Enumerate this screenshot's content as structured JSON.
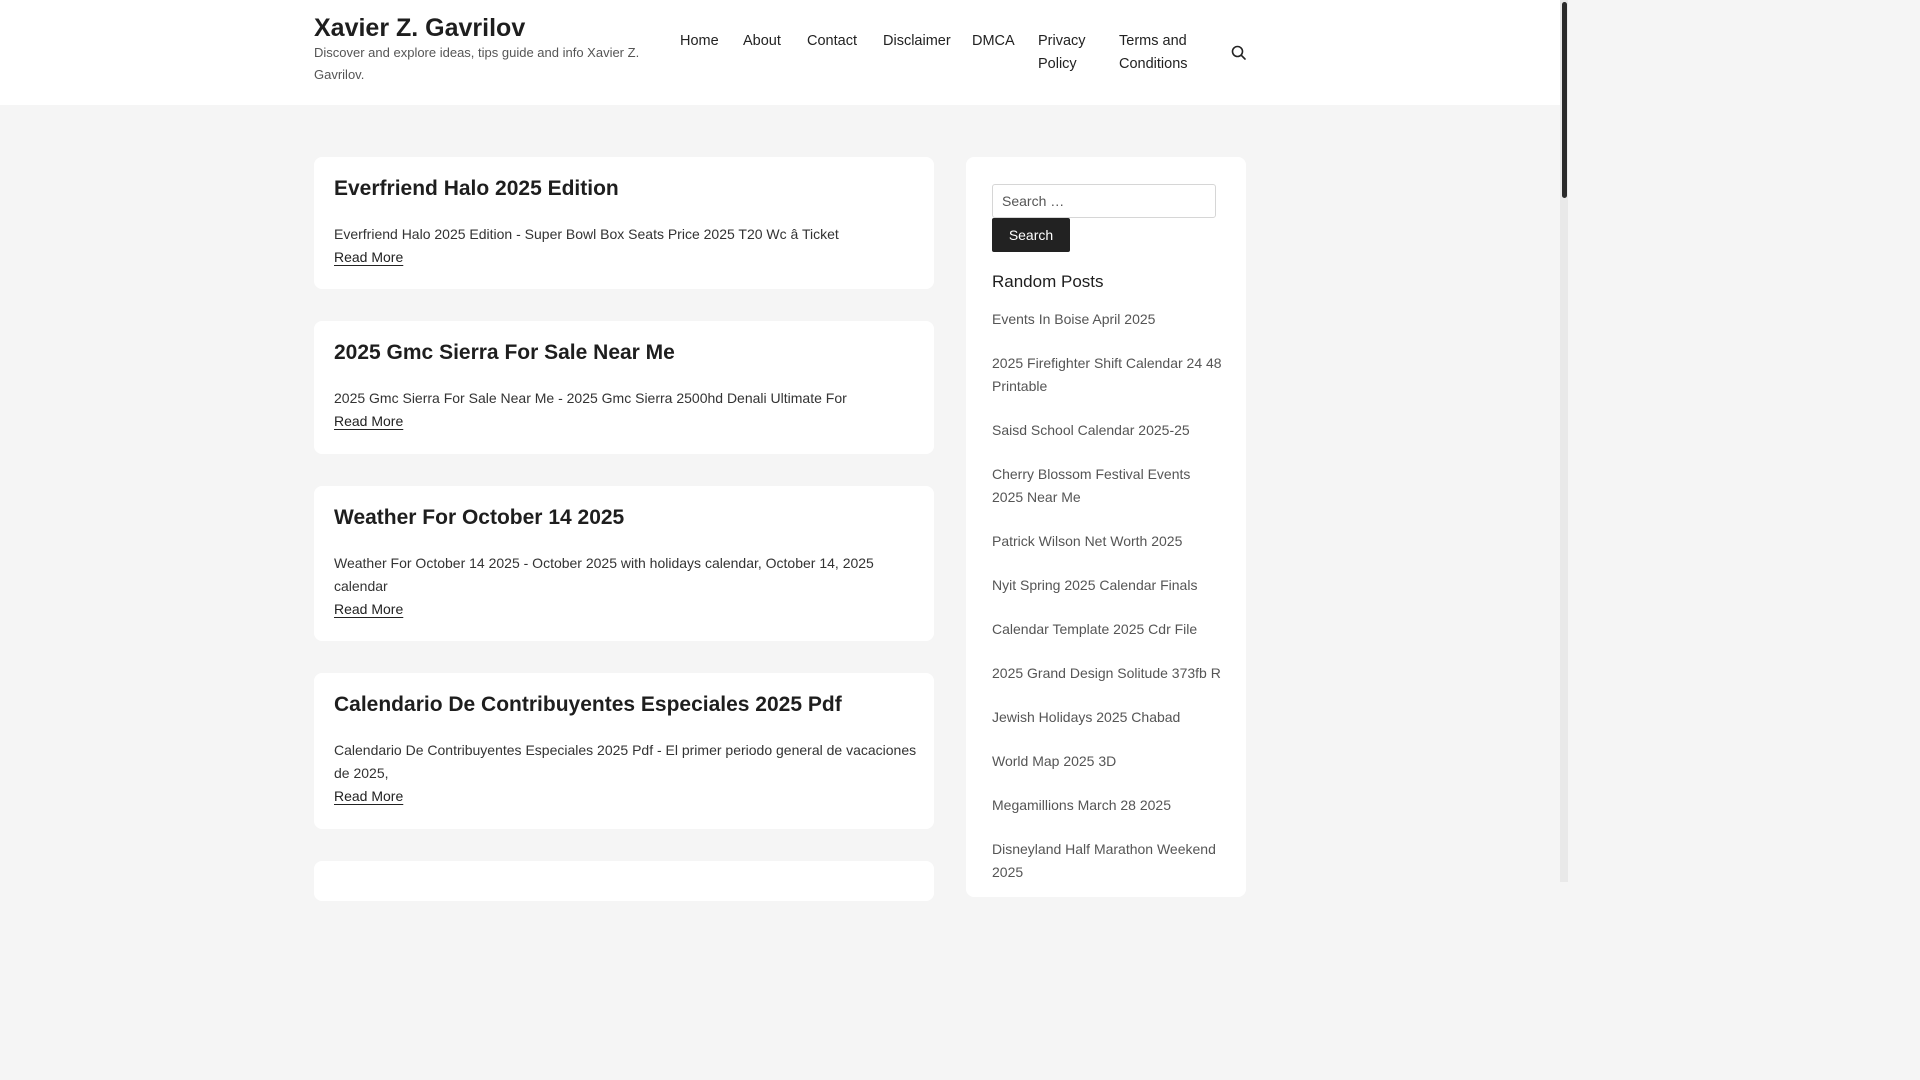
{
  "site": {
    "title": "Xavier Z. Gavrilov",
    "tagline": "Discover and explore ideas, tips guide and info Xavier Z. Gavrilov."
  },
  "nav": {
    "home": "Home",
    "about": "About",
    "contact": "Contact",
    "disclaimer": "Disclaimer",
    "dmca": "DMCA",
    "privacy": "Privacy Policy",
    "terms": "Terms and Conditions",
    "search_icon": "search-icon"
  },
  "posts": [
    {
      "title": "Everfriend Halo 2025 Edition",
      "excerpt": "Everfriend Halo 2025 Edition - Super Bowl Box Seats Price 2025 T20 Wc â Ticket",
      "read_more": "Read More"
    },
    {
      "title": "2025 Gmc Sierra For Sale Near Me",
      "excerpt": "2025 Gmc Sierra For Sale Near Me - 2025 Gmc Sierra 2500hd Denali Ultimate For",
      "read_more": "Read More"
    },
    {
      "title": "Weather For October 14 2025",
      "excerpt": "Weather For October 14 2025 - October 2025 with holidays calendar, October 14, 2025 calendar",
      "read_more": "Read More"
    },
    {
      "title": "Calendario De Contribuyentes Especiales 2025 Pdf",
      "excerpt": "Calendario De Contribuyentes Especiales 2025 Pdf - El primer periodo general de vacaciones de 2025,",
      "read_more": "Read More"
    }
  ],
  "sidebar": {
    "search_placeholder": "Search …",
    "search_button": "Search",
    "random_heading": "Random Posts",
    "random_posts": [
      "Events In Boise April 2025",
      "2025 Firefighter Shift Calendar 24 48 Printable",
      "Saisd School Calendar 2025-25",
      "Cherry Blossom Festival Events 2025 Near Me",
      "Patrick Wilson Net Worth 2025",
      "Nyit Spring 2025 Calendar Finals",
      "Calendar Template 2025 Cdr File",
      "2025 Grand Design Solitude 373fb R",
      "Jewish Holidays 2025 Chabad",
      "World Map 2025 3D",
      "Megamillions March 28 2025",
      "Disneyland Half Marathon Weekend 2025"
    ]
  }
}
